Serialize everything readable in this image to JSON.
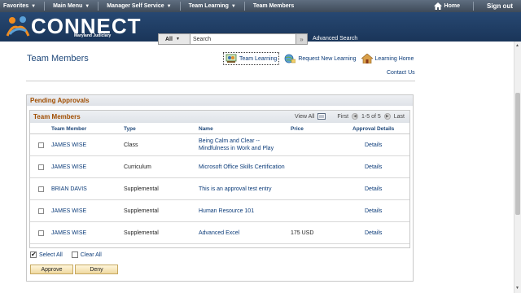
{
  "topnav": {
    "favorites": "Favorites",
    "main_menu": "Main Menu",
    "manager_self_service": "Manager Self Service",
    "team_learning": "Team Learning",
    "team_members": "Team Members",
    "home": "Home",
    "sign_out": "Sign out"
  },
  "banner": {
    "logo": "CONNECT",
    "logo_sub": "Maryland Judiciary",
    "search_scope": "All",
    "search_value": "Search",
    "advanced_search": "Advanced Search"
  },
  "page": {
    "title": "Team Members",
    "links": {
      "team_learning": "Team Learning",
      "request_new_learning": "Request New Learning",
      "learning_home": "Learning Home",
      "contact_us": "Contact Us"
    }
  },
  "pending": {
    "title": "Pending Approvals",
    "grid_title": "Team Members",
    "view_all": "View All",
    "first": "First",
    "range": "1-5 of 5",
    "last": "Last",
    "columns": {
      "member": "Team Member",
      "type": "Type",
      "name": "Name",
      "price": "Price",
      "details": "Approval Details"
    },
    "rows": [
      {
        "member": "JAMES WISE",
        "type": "Class",
        "name1": "Being Calm and Clear --",
        "name2": "Mindfulness in Work and Play",
        "price": "",
        "details": "Details"
      },
      {
        "member": "JAMES WISE",
        "type": "Curriculum",
        "name1": "Microsoft Office Skills Certification",
        "name2": "",
        "price": "",
        "details": "Details"
      },
      {
        "member": "BRIAN DAVIS",
        "type": "Supplemental",
        "name1": "This is an approval test entry",
        "name2": "",
        "price": "",
        "details": "Details"
      },
      {
        "member": "JAMES WISE",
        "type": "Supplemental",
        "name1": "Human Resource 101",
        "name2": "",
        "price": "",
        "details": "Details"
      },
      {
        "member": "JAMES WISE",
        "type": "Supplemental",
        "name1": "Advanced Excel",
        "name2": "",
        "price": "175 USD",
        "details": "Details"
      }
    ],
    "select_all": "Select All",
    "clear_all": "Clear All",
    "approve": "Approve",
    "deny": "Deny"
  }
}
